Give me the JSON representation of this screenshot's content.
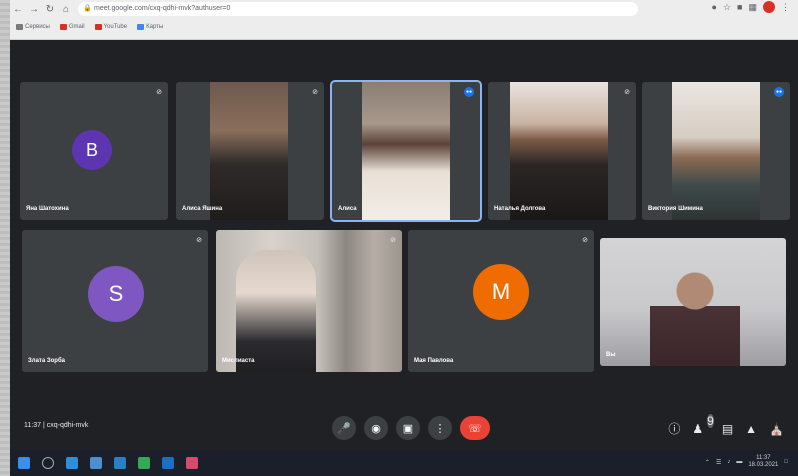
{
  "browser": {
    "url": "meet.google.com/cxq-qdhi-mvk?authuser=0",
    "bookmarks": [
      {
        "label": "Сервисы",
        "icon": "apps-icon"
      },
      {
        "label": "Gmail",
        "icon": "gmail-icon"
      },
      {
        "label": "YouTube",
        "icon": "youtube-icon"
      },
      {
        "label": "Карты",
        "icon": "maps-icon"
      }
    ]
  },
  "tiles": [
    {
      "name": "Яна Шатохина",
      "type": "avatar",
      "letter": "B",
      "avatar_color": "#5e35b1",
      "mic": "off"
    },
    {
      "name": "Алиса Яшина",
      "type": "video",
      "mic": "off"
    },
    {
      "name": "Алиса",
      "type": "video",
      "mic": "speaking",
      "active": true
    },
    {
      "name": "Наталья Долгова",
      "type": "video",
      "mic": "off"
    },
    {
      "name": "Виктория Шимина",
      "type": "video",
      "mic": "speaking"
    },
    {
      "name": "Злата Зорба",
      "type": "avatar",
      "letter": "S",
      "avatar_color": "#7e57c2",
      "mic": "off"
    },
    {
      "name": "Мислиаста",
      "type": "video",
      "mic": "off"
    },
    {
      "name": "Мая Павлова",
      "type": "avatar",
      "letter": "M",
      "avatar_color": "#ef6c00",
      "mic": "off"
    },
    {
      "name": "Вы",
      "type": "video",
      "mic": "on"
    }
  ],
  "controls": {
    "time": "11:37",
    "separator": "|",
    "meeting_code": "cxq-qdhi-mvk",
    "participants_badge": "9"
  },
  "taskbar": {
    "clock_time": "11:37",
    "clock_date": "18.03.2021"
  }
}
